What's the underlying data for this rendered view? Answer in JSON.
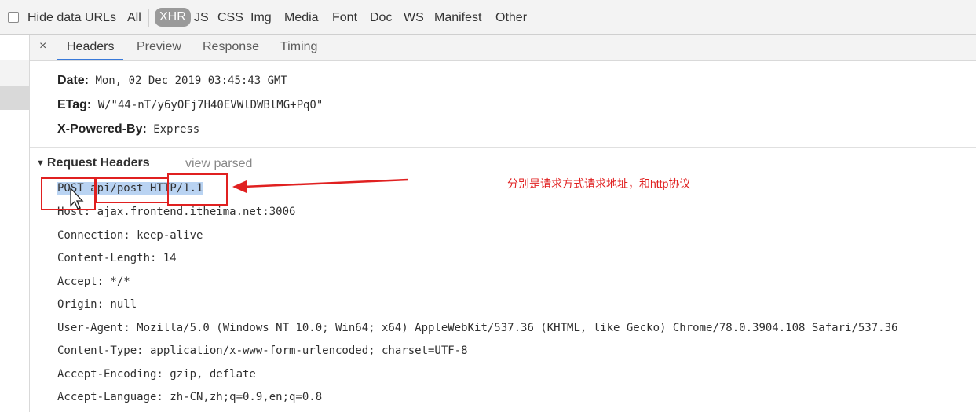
{
  "filter_bar": {
    "hide_data_urls_label": "Hide data URLs",
    "hide_data_urls_checked": false,
    "types": [
      "All",
      "XHR",
      "JS",
      "CSS",
      "Img",
      "Media",
      "Font",
      "Doc",
      "WS",
      "Manifest",
      "Other"
    ],
    "active_type": "XHR"
  },
  "tabs": {
    "close_glyph": "×",
    "items": [
      "Headers",
      "Preview",
      "Response",
      "Timing"
    ],
    "active": "Headers"
  },
  "response_headers": [
    {
      "name": "Date:",
      "value": "Mon, 02 Dec 2019 03:45:43 GMT"
    },
    {
      "name": "ETag:",
      "value": "W/\"44-nT/y6yOFj7H40EVWlDWBlMG+Pq0\""
    },
    {
      "name": "X-Powered-By:",
      "value": "Express"
    }
  ],
  "request_section": {
    "title": "Request Headers",
    "view_parsed": "view parsed",
    "request_line": {
      "method": "POST",
      "path": "api/post",
      "protocol": "HTTP/1.1"
    },
    "headers": [
      "Host: ajax.frontend.itheima.net:3006",
      "Connection: keep-alive",
      "Content-Length: 14",
      "Accept: */*",
      "Origin: null",
      "User-Agent: Mozilla/5.0 (Windows NT 10.0; Win64; x64) AppleWebKit/537.36 (KHTML, like Gecko) Chrome/78.0.3904.108 Safari/537.36",
      "Content-Type: application/x-www-form-urlencoded; charset=UTF-8",
      "Accept-Encoding: gzip, deflate",
      "Accept-Language: zh-CN,zh;q=0.9,en;q=0.8"
    ]
  },
  "annotation": {
    "text": "分别是请求方式请求地址，和http协议",
    "color": "#e02020"
  },
  "colors": {
    "accent_tab": "#3879d9",
    "selection": "#b9d3f2",
    "annotation_red": "#e02020"
  }
}
